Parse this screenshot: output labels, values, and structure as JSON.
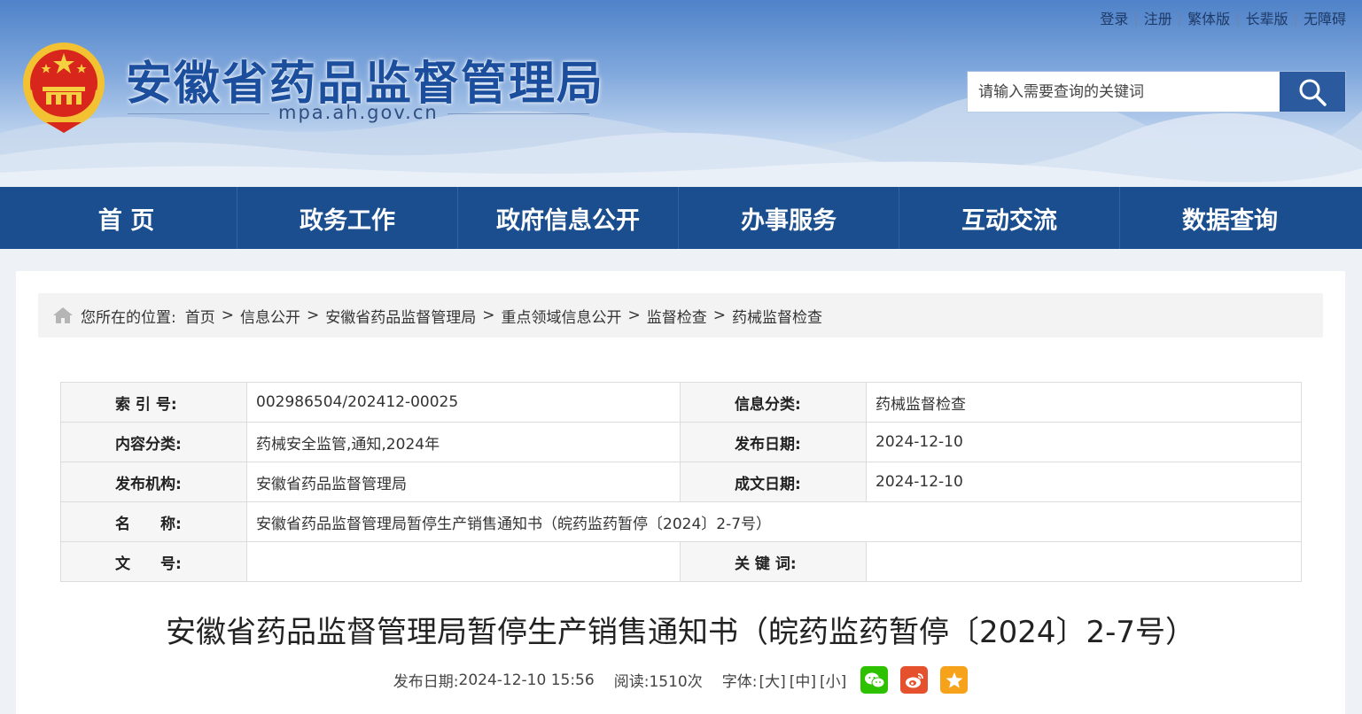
{
  "header": {
    "site_title": "安徽省药品监督管理局",
    "site_domain": "mpa.ah.gov.cn",
    "top_links": [
      "登录",
      "注册",
      "繁体版",
      "长辈版",
      "无障碍"
    ],
    "search_placeholder": "请输入需要查询的关键词"
  },
  "nav": {
    "items": [
      "首 页",
      "政务工作",
      "政府信息公开",
      "办事服务",
      "互动交流",
      "数据查询"
    ]
  },
  "breadcrumb": {
    "prefix": "您所在的位置:",
    "items": [
      "首页",
      "信息公开",
      "安徽省药品监督管理局",
      "重点领域信息公开",
      "监督检查",
      "药械监督检查"
    ],
    "separator": ">"
  },
  "meta_table": {
    "index_label": "索 引 号:",
    "index_value": "002986504/202412-00025",
    "info_cat_label": "信息分类:",
    "info_cat_value": "药械监督检查",
    "content_cat_label": "内容分类:",
    "content_cat_value": "药械安全监管,通知,2024年",
    "publish_date_label": "发布日期:",
    "publish_date_value": "2024-12-10",
    "org_label": "发布机构:",
    "org_value": "安徽省药品监督管理局",
    "created_date_label": "成文日期:",
    "created_date_value": "2024-12-10",
    "name_label": "名　　称:",
    "name_value": "安徽省药品监督管理局暂停生产销售通知书（皖药监药暂停〔2024〕2-7号）",
    "doc_no_label": "文　　号:",
    "doc_no_value": "",
    "keywords_label": "关 键 词:",
    "keywords_value": ""
  },
  "article": {
    "title": "安徽省药品监督管理局暂停生产销售通知书（皖药监药暂停〔2024〕2-7号）",
    "publish_label": "发布日期:",
    "publish_time": "2024-12-10 15:56",
    "read_label": "阅读:",
    "read_count": "1510次",
    "font_label": "字体:",
    "font_large": "[大]",
    "font_medium": "[中]",
    "font_small": "[小]"
  },
  "colors": {
    "nav_bg": "#1b4e8e",
    "title_blue": "#1c4e9e",
    "search_btn": "#2b5b9e",
    "wechat": "#2dc100",
    "weibo": "#e6512d",
    "favorite": "#f7a21b"
  },
  "icons": {
    "emblem": "national-emblem-icon",
    "search": "search-icon",
    "home": "home-icon",
    "wechat": "wechat-icon",
    "weibo": "weibo-icon",
    "favorite": "star-icon"
  }
}
